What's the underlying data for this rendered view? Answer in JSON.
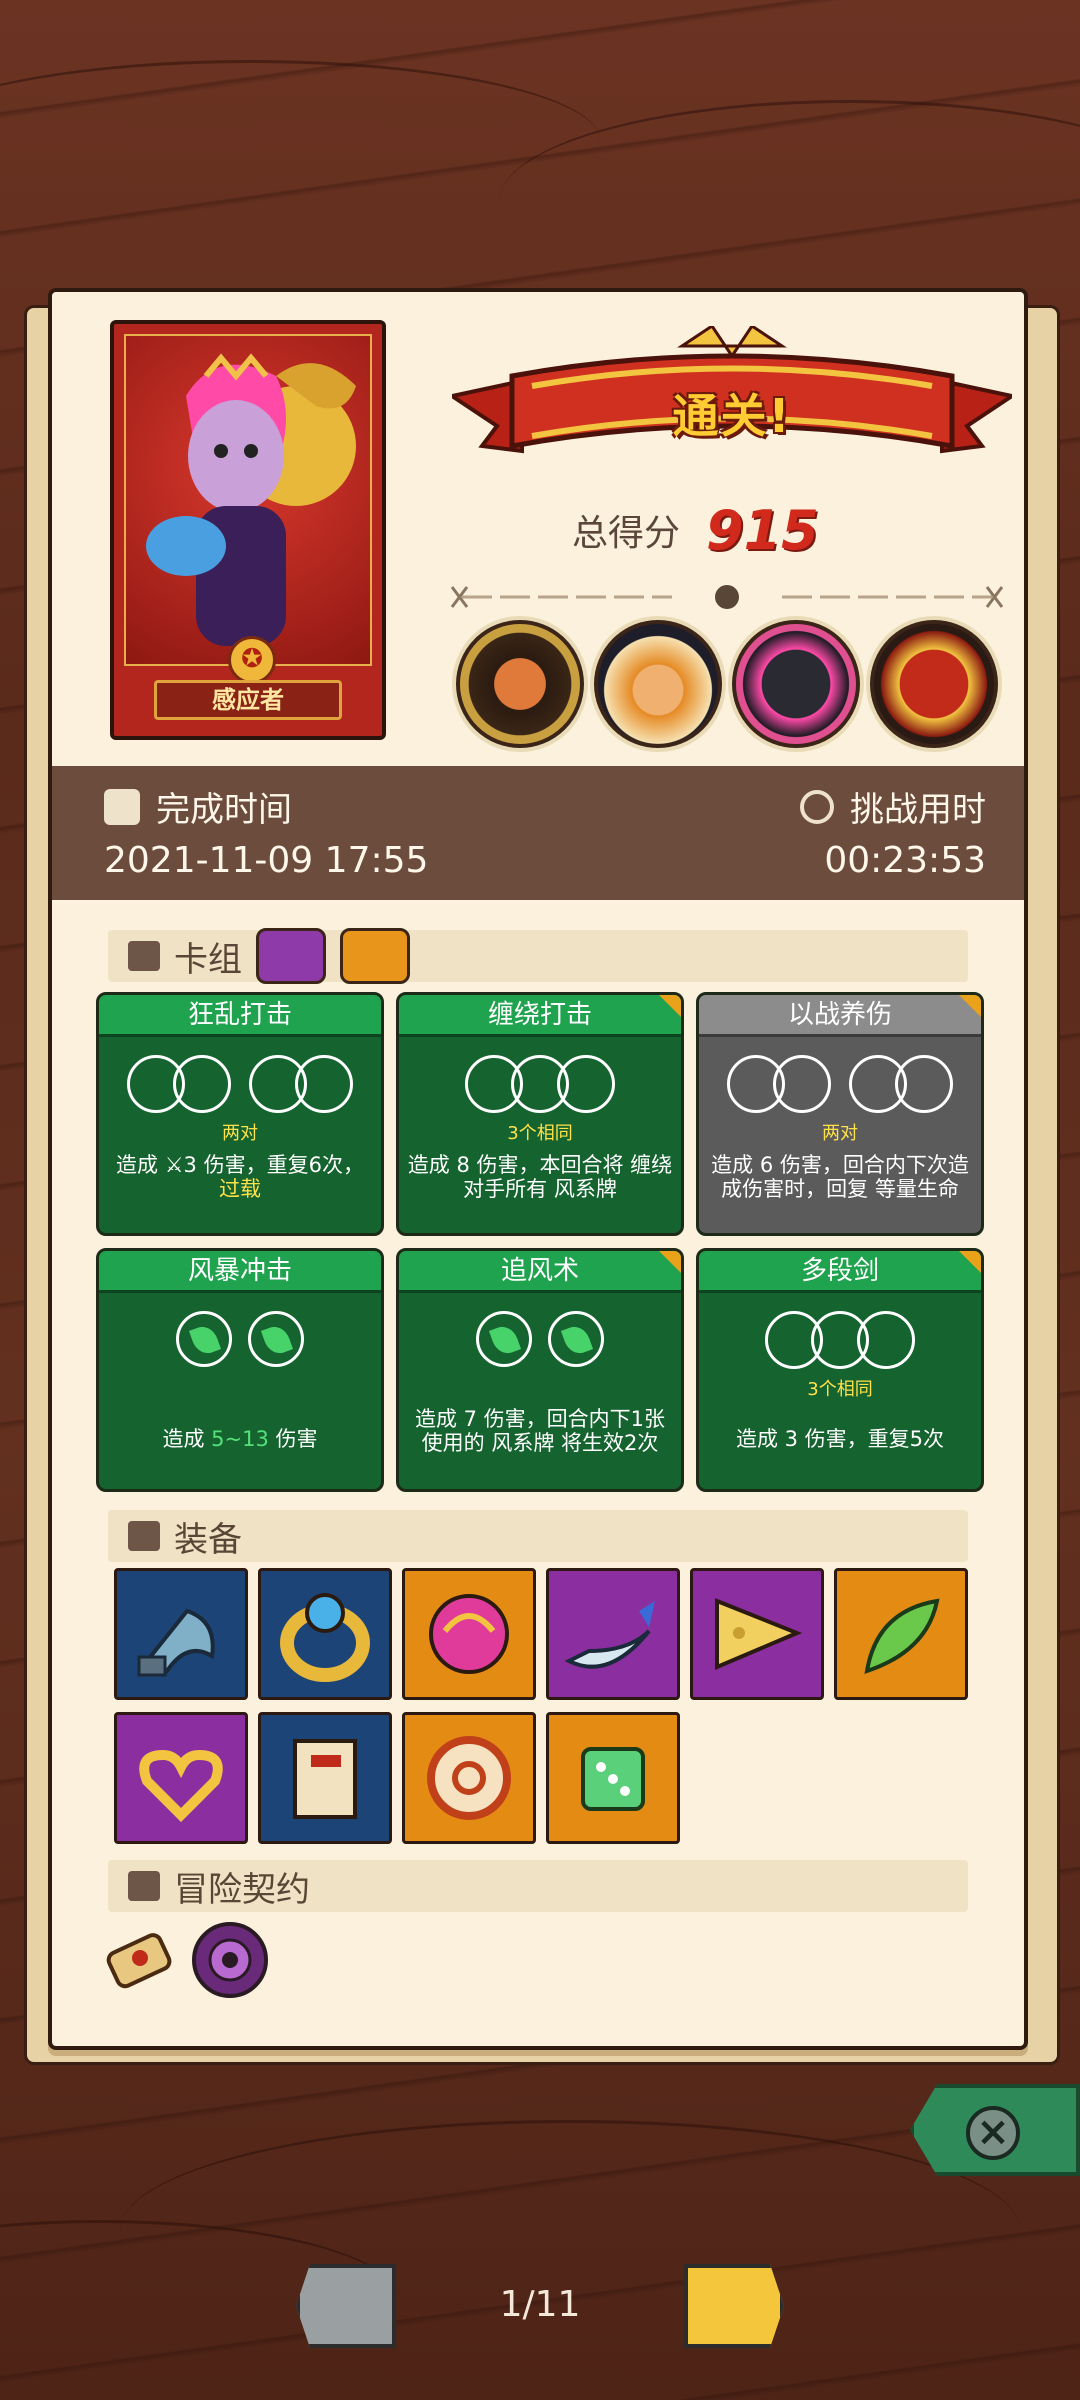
{
  "result": {
    "banner": "通关!",
    "score_label": "总得分",
    "score_value": "915"
  },
  "hero": {
    "name": "感应者"
  },
  "bosses": [
    "cyclops-boss",
    "monk-boss",
    "dark-knight-boss",
    "red-demon-boss"
  ],
  "times": {
    "completion_label": "完成时间",
    "completion_value": "2021-11-09 17:55",
    "duration_label": "挑战用时",
    "duration_value": "00:23:53"
  },
  "deck": {
    "label": "卡组",
    "tags": [
      "purple-eye-tag",
      "wind-spiral-tag"
    ],
    "cards": [
      {
        "title": "狂乱打击",
        "combo": "两对",
        "desc_pre": "造成 ",
        "desc_main": "3 伤害，重复6次，",
        "desc_hl": "过载",
        "style": "green"
      },
      {
        "title": "缠绕打击",
        "combo": "3个相同",
        "desc": "造成 8 伤害，本回合将 缠绕对手所有 风系牌",
        "style": "green"
      },
      {
        "title": "以战养伤",
        "combo": "两对",
        "desc": "造成 6 伤害，回合内下次造成伤害时，回复 等量生命",
        "style": "gray"
      },
      {
        "title": "风暴冲击",
        "desc_pre": "造成 ",
        "desc_gn": "5~13",
        "desc_post": " 伤害",
        "style": "green"
      },
      {
        "title": "追风术",
        "desc": "造成 7 伤害，回合内下1张使用的 风系牌 将生效2次",
        "style": "green"
      },
      {
        "title": "多段剑",
        "combo": "3个相同",
        "desc": "造成 3 伤害，重复5次",
        "style": "green"
      }
    ]
  },
  "equipment": {
    "label": "装备",
    "items": [
      "axe-head",
      "gold-ring",
      "pink-orb",
      "crescent-blade",
      "cheese-wedge",
      "green-feather",
      "heart-necklace",
      "scroll",
      "gold-coin",
      "green-dice"
    ]
  },
  "contract": {
    "label": "冒险契约",
    "items": [
      "scroll-contract",
      "purple-eye-contract"
    ]
  },
  "pagination": {
    "label": "1/11"
  },
  "colors": {
    "accent_red": "#d12a1c",
    "card_green": "#15632f",
    "card_gray": "#5b5b5b",
    "time_bar": "#6c4c3d"
  }
}
